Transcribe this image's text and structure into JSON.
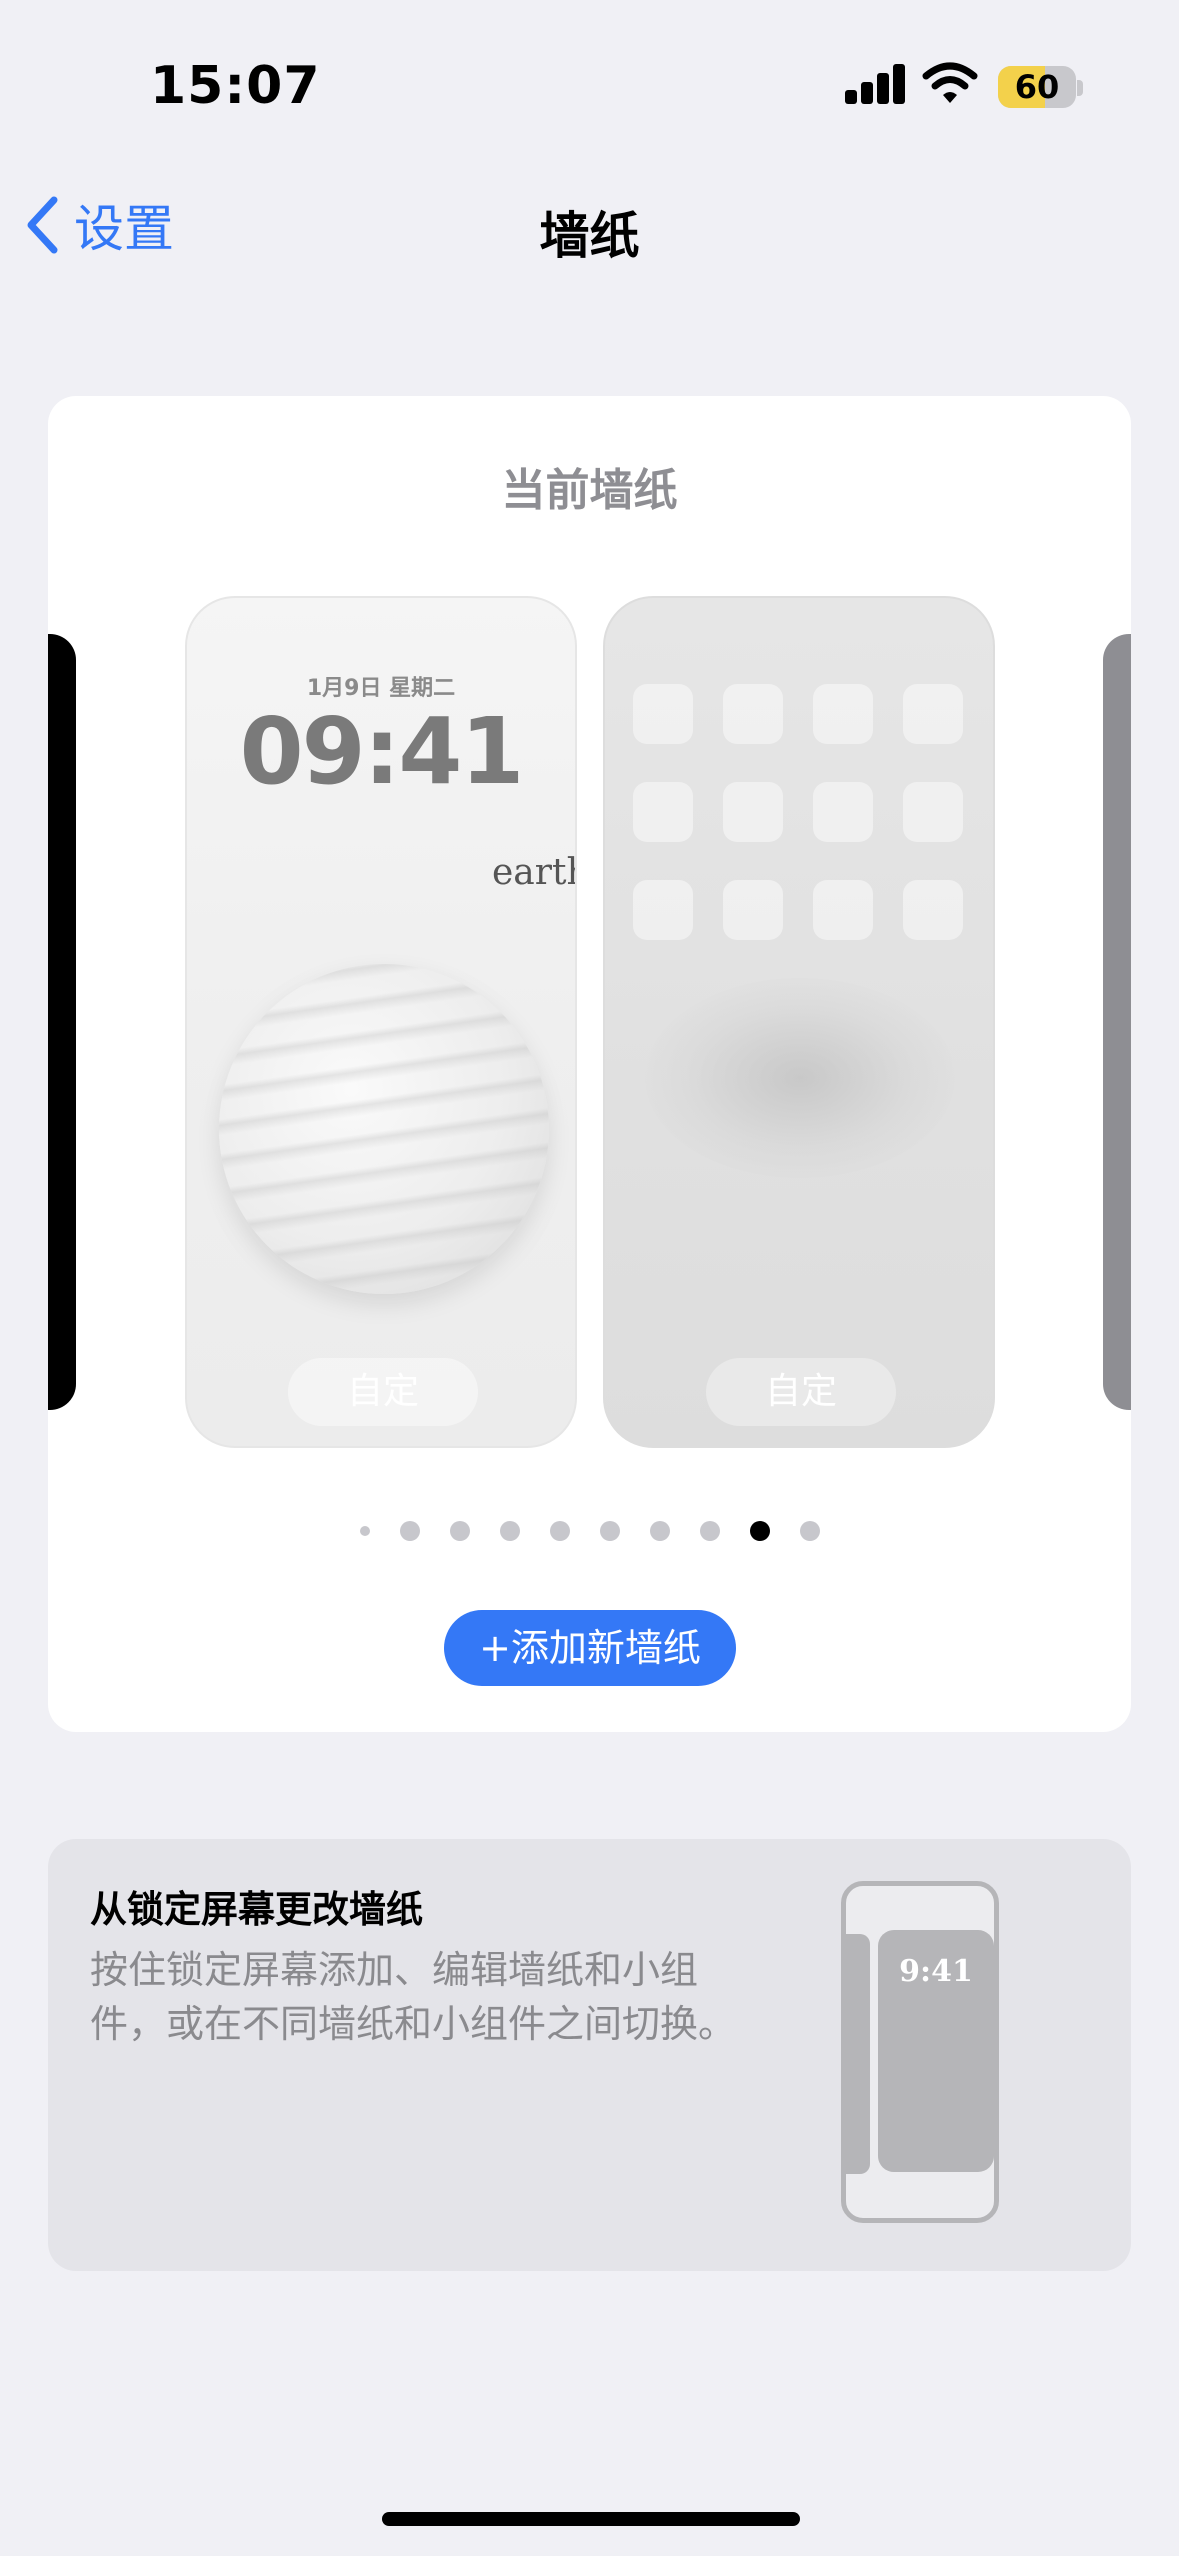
{
  "status_bar": {
    "time": "15:07",
    "battery_level": "60",
    "battery_fraction": 0.6,
    "battery_color": "#F3D14B"
  },
  "nav": {
    "back_label": "设置",
    "title": "墙纸",
    "accent_color": "#3478F6"
  },
  "wallpaper_card": {
    "title": "当前墙纸",
    "lock_preview": {
      "date": "1月9日 星期二",
      "time": "09:41",
      "overlay_text": "earth",
      "customize_label": "自定"
    },
    "home_preview": {
      "customize_label": "自定",
      "app_icon_rows": 3,
      "app_icon_cols": 4
    },
    "page_indicator": {
      "count": 10,
      "active_index": 8
    },
    "add_button_label": "+添加新墙纸"
  },
  "tip_card": {
    "title": "从锁定屏幕更改墙纸",
    "body": "按住锁定屏幕添加、编辑墙纸和小组件，或在不同墙纸和小组件之间切换。",
    "illustration_time": "9:41"
  }
}
